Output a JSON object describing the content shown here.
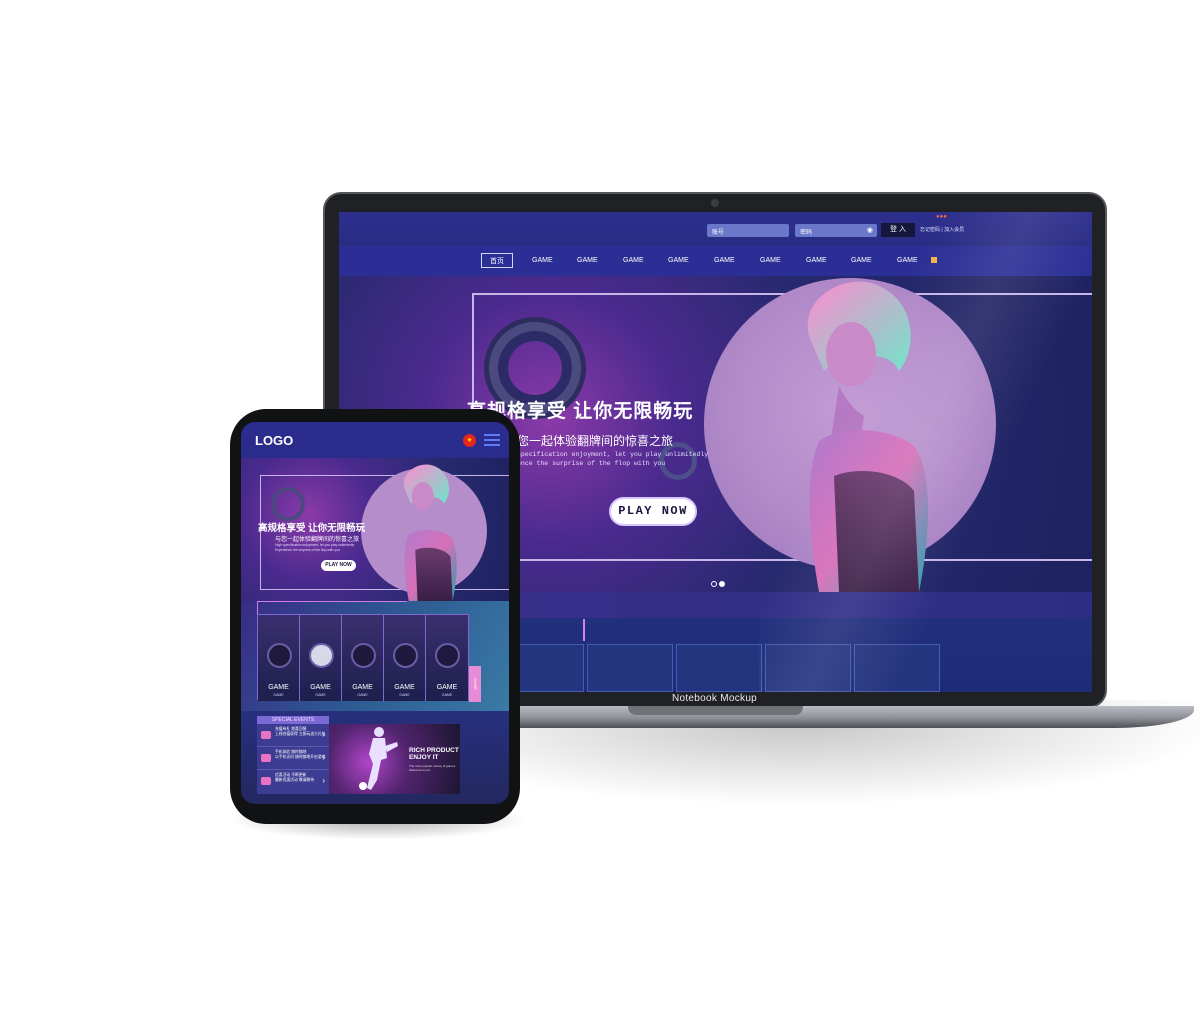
{
  "mockup": {
    "caption": "Notebook Mockup"
  },
  "desktop": {
    "login": {
      "account_placeholder": "账号",
      "password_placeholder": "密码",
      "login_button": "登 入",
      "links": "忘记密码 | 加入会员"
    },
    "nav": {
      "home": "首页",
      "items": [
        "GAME",
        "GAME",
        "GAME",
        "GAME",
        "GAME",
        "GAME",
        "GAME",
        "GAME",
        "GAME"
      ]
    },
    "hero": {
      "title": "高规格享受 让你无限畅玩",
      "subtitle": "您一起体验翻牌间的惊喜之旅",
      "english_line1": "specification enjoyment, let you play unlimitedly",
      "english_line2": "ence the surprise of the flop with you",
      "play_button": "PLAY NOW"
    }
  },
  "mobile": {
    "logo": "LOGO",
    "hero": {
      "title": "高规格享受 让你无限畅玩",
      "subtitle": "与您一起体验翻牌间的惊喜之旅",
      "english_line1": "High specification enjoyment, let you play unlimitedly",
      "english_line2": "Experience the surprise of the flop with you",
      "play_button": "PLAY NOW"
    },
    "games": {
      "items": [
        {
          "label": "GAME",
          "sub": "GAME"
        },
        {
          "label": "GAME",
          "sub": "GAME"
        },
        {
          "label": "GAME",
          "sub": "GAME"
        },
        {
          "label": "GAME",
          "sub": "GAME"
        },
        {
          "label": "GAME",
          "sub": "GAME"
        }
      ],
      "side_tab": "GAME"
    },
    "events": {
      "heading": "SPECIAL EVENTS",
      "items": [
        {
          "title": "充值有礼 惊喜回馈",
          "desc": "上线充值获得 立即玩送大礼包"
        },
        {
          "title": "手机体验 随时随地",
          "desc": "以手机访问 随时随地开启游戏"
        },
        {
          "title": "优惠活动 不断更新",
          "desc": "最新优惠活动 敬请期待"
        }
      ],
      "banner_title": "RICH PRODUCT",
      "banner_title2": "ENJOY IT",
      "banner_desc1": "The most popular variety of games",
      "banner_desc2": "Welcome to join"
    }
  },
  "colors": {
    "primary": "#2b2f95",
    "accent_pink": "#e68bd6",
    "hero_purple": "#8b3aa9"
  }
}
